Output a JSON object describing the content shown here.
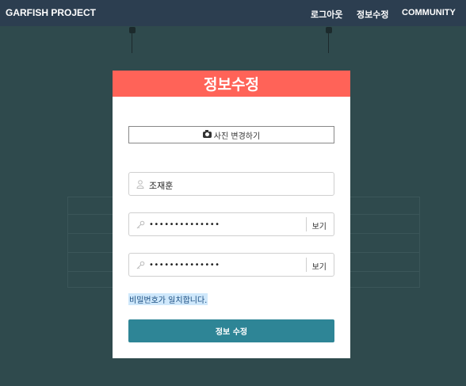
{
  "navbar": {
    "brand": "GARFISH PROJECT",
    "links": [
      "로그아웃",
      "정보수정",
      "COMMUNITY"
    ]
  },
  "modal": {
    "title": "정보수정",
    "photo_button_label": "사진 변경하기",
    "name_value": "조재훈",
    "password_value": "••••••••••••••",
    "password_confirm_value": "••••••••••••••",
    "show_label": "보기",
    "match_message": "비밀번호가 일치합니다.",
    "submit_label": "정보 수정"
  },
  "colors": {
    "navbar_bg": "#2c3e50",
    "modal_header": "#ff6358",
    "submit_button": "#2e8596",
    "backdrop": "#2f4a4d"
  },
  "icons": {
    "photo": "camera-icon",
    "name": "user-icon",
    "password": "key-icon"
  }
}
